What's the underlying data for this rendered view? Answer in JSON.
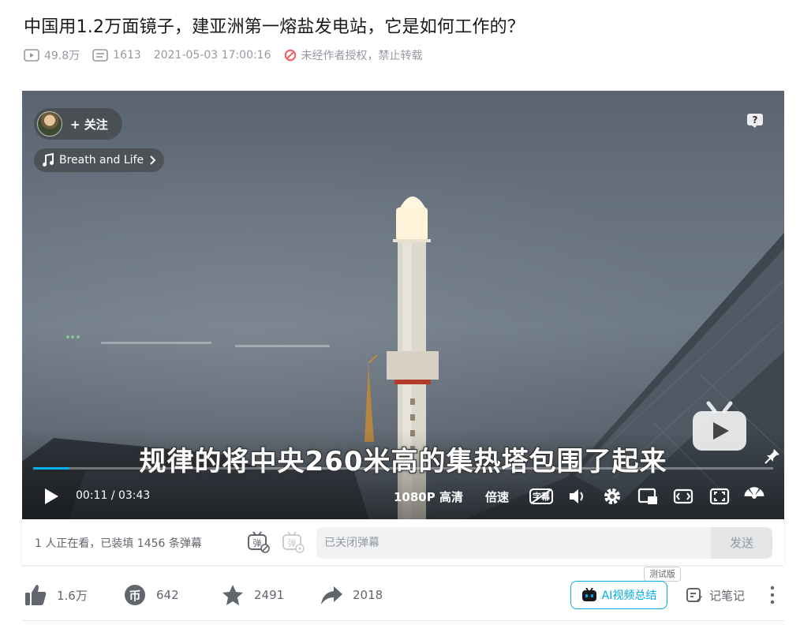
{
  "video": {
    "title": "中国用1.2万面镜子，建亚洲第一熔盐发电站，它是如何工作的？",
    "play_count": "49.8万",
    "danmaku_count": "1613",
    "publish_time": "2021-05-03 17:00:16",
    "copyright_notice": "未经作者授权，禁止转载"
  },
  "player": {
    "follow_label": "+ 关注",
    "music_label": "Breath and Life",
    "subtitle_text": "规律的将中央260米高的集热塔包围了起来",
    "current_time": "00:11",
    "time_separator": "/",
    "duration": "03:43",
    "progress": 0.049,
    "quality_label": "1080P 高清",
    "speed_label": "倍速",
    "subtitle_toggle_label": "字幕"
  },
  "danmaku_bar": {
    "info_text": "1 人正在看，已装填 1456 条弹幕",
    "input_placeholder": "已关闭弹幕",
    "send_label": "发送"
  },
  "toolbar": {
    "like_count": "1.6万",
    "coin_count": "642",
    "favorite_count": "2491",
    "share_count": "2018",
    "ai_summary_label": "AI视频总结",
    "beta_badge": "测试版",
    "notes_label": "记笔记"
  },
  "colors": {
    "accent": "#00aeec",
    "text_primary": "#18191c",
    "text_secondary": "#61666d",
    "text_muted": "#9499a0",
    "no_repost_red": "#f25d59"
  }
}
